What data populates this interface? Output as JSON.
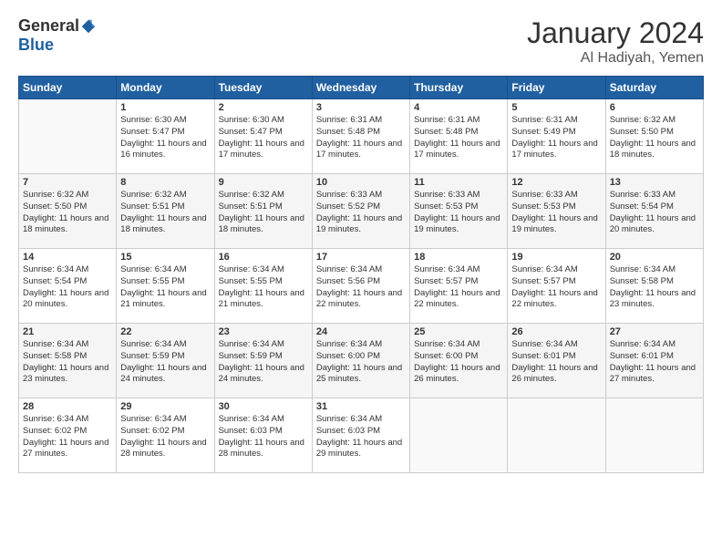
{
  "logo": {
    "general": "General",
    "blue": "Blue"
  },
  "title": "January 2024",
  "location": "Al Hadiyah, Yemen",
  "days_of_week": [
    "Sunday",
    "Monday",
    "Tuesday",
    "Wednesday",
    "Thursday",
    "Friday",
    "Saturday"
  ],
  "weeks": [
    [
      {
        "num": "",
        "empty": true
      },
      {
        "num": "1",
        "sunrise": "Sunrise: 6:30 AM",
        "sunset": "Sunset: 5:47 PM",
        "daylight": "Daylight: 11 hours and 16 minutes."
      },
      {
        "num": "2",
        "sunrise": "Sunrise: 6:30 AM",
        "sunset": "Sunset: 5:47 PM",
        "daylight": "Daylight: 11 hours and 17 minutes."
      },
      {
        "num": "3",
        "sunrise": "Sunrise: 6:31 AM",
        "sunset": "Sunset: 5:48 PM",
        "daylight": "Daylight: 11 hours and 17 minutes."
      },
      {
        "num": "4",
        "sunrise": "Sunrise: 6:31 AM",
        "sunset": "Sunset: 5:48 PM",
        "daylight": "Daylight: 11 hours and 17 minutes."
      },
      {
        "num": "5",
        "sunrise": "Sunrise: 6:31 AM",
        "sunset": "Sunset: 5:49 PM",
        "daylight": "Daylight: 11 hours and 17 minutes."
      },
      {
        "num": "6",
        "sunrise": "Sunrise: 6:32 AM",
        "sunset": "Sunset: 5:50 PM",
        "daylight": "Daylight: 11 hours and 18 minutes."
      }
    ],
    [
      {
        "num": "7",
        "sunrise": "Sunrise: 6:32 AM",
        "sunset": "Sunset: 5:50 PM",
        "daylight": "Daylight: 11 hours and 18 minutes."
      },
      {
        "num": "8",
        "sunrise": "Sunrise: 6:32 AM",
        "sunset": "Sunset: 5:51 PM",
        "daylight": "Daylight: 11 hours and 18 minutes."
      },
      {
        "num": "9",
        "sunrise": "Sunrise: 6:32 AM",
        "sunset": "Sunset: 5:51 PM",
        "daylight": "Daylight: 11 hours and 18 minutes."
      },
      {
        "num": "10",
        "sunrise": "Sunrise: 6:33 AM",
        "sunset": "Sunset: 5:52 PM",
        "daylight": "Daylight: 11 hours and 19 minutes."
      },
      {
        "num": "11",
        "sunrise": "Sunrise: 6:33 AM",
        "sunset": "Sunset: 5:53 PM",
        "daylight": "Daylight: 11 hours and 19 minutes."
      },
      {
        "num": "12",
        "sunrise": "Sunrise: 6:33 AM",
        "sunset": "Sunset: 5:53 PM",
        "daylight": "Daylight: 11 hours and 19 minutes."
      },
      {
        "num": "13",
        "sunrise": "Sunrise: 6:33 AM",
        "sunset": "Sunset: 5:54 PM",
        "daylight": "Daylight: 11 hours and 20 minutes."
      }
    ],
    [
      {
        "num": "14",
        "sunrise": "Sunrise: 6:34 AM",
        "sunset": "Sunset: 5:54 PM",
        "daylight": "Daylight: 11 hours and 20 minutes."
      },
      {
        "num": "15",
        "sunrise": "Sunrise: 6:34 AM",
        "sunset": "Sunset: 5:55 PM",
        "daylight": "Daylight: 11 hours and 21 minutes."
      },
      {
        "num": "16",
        "sunrise": "Sunrise: 6:34 AM",
        "sunset": "Sunset: 5:55 PM",
        "daylight": "Daylight: 11 hours and 21 minutes."
      },
      {
        "num": "17",
        "sunrise": "Sunrise: 6:34 AM",
        "sunset": "Sunset: 5:56 PM",
        "daylight": "Daylight: 11 hours and 22 minutes."
      },
      {
        "num": "18",
        "sunrise": "Sunrise: 6:34 AM",
        "sunset": "Sunset: 5:57 PM",
        "daylight": "Daylight: 11 hours and 22 minutes."
      },
      {
        "num": "19",
        "sunrise": "Sunrise: 6:34 AM",
        "sunset": "Sunset: 5:57 PM",
        "daylight": "Daylight: 11 hours and 22 minutes."
      },
      {
        "num": "20",
        "sunrise": "Sunrise: 6:34 AM",
        "sunset": "Sunset: 5:58 PM",
        "daylight": "Daylight: 11 hours and 23 minutes."
      }
    ],
    [
      {
        "num": "21",
        "sunrise": "Sunrise: 6:34 AM",
        "sunset": "Sunset: 5:58 PM",
        "daylight": "Daylight: 11 hours and 23 minutes."
      },
      {
        "num": "22",
        "sunrise": "Sunrise: 6:34 AM",
        "sunset": "Sunset: 5:59 PM",
        "daylight": "Daylight: 11 hours and 24 minutes."
      },
      {
        "num": "23",
        "sunrise": "Sunrise: 6:34 AM",
        "sunset": "Sunset: 5:59 PM",
        "daylight": "Daylight: 11 hours and 24 minutes."
      },
      {
        "num": "24",
        "sunrise": "Sunrise: 6:34 AM",
        "sunset": "Sunset: 6:00 PM",
        "daylight": "Daylight: 11 hours and 25 minutes."
      },
      {
        "num": "25",
        "sunrise": "Sunrise: 6:34 AM",
        "sunset": "Sunset: 6:00 PM",
        "daylight": "Daylight: 11 hours and 26 minutes."
      },
      {
        "num": "26",
        "sunrise": "Sunrise: 6:34 AM",
        "sunset": "Sunset: 6:01 PM",
        "daylight": "Daylight: 11 hours and 26 minutes."
      },
      {
        "num": "27",
        "sunrise": "Sunrise: 6:34 AM",
        "sunset": "Sunset: 6:01 PM",
        "daylight": "Daylight: 11 hours and 27 minutes."
      }
    ],
    [
      {
        "num": "28",
        "sunrise": "Sunrise: 6:34 AM",
        "sunset": "Sunset: 6:02 PM",
        "daylight": "Daylight: 11 hours and 27 minutes."
      },
      {
        "num": "29",
        "sunrise": "Sunrise: 6:34 AM",
        "sunset": "Sunset: 6:02 PM",
        "daylight": "Daylight: 11 hours and 28 minutes."
      },
      {
        "num": "30",
        "sunrise": "Sunrise: 6:34 AM",
        "sunset": "Sunset: 6:03 PM",
        "daylight": "Daylight: 11 hours and 28 minutes."
      },
      {
        "num": "31",
        "sunrise": "Sunrise: 6:34 AM",
        "sunset": "Sunset: 6:03 PM",
        "daylight": "Daylight: 11 hours and 29 minutes."
      },
      {
        "num": "",
        "empty": true
      },
      {
        "num": "",
        "empty": true
      },
      {
        "num": "",
        "empty": true
      }
    ]
  ]
}
